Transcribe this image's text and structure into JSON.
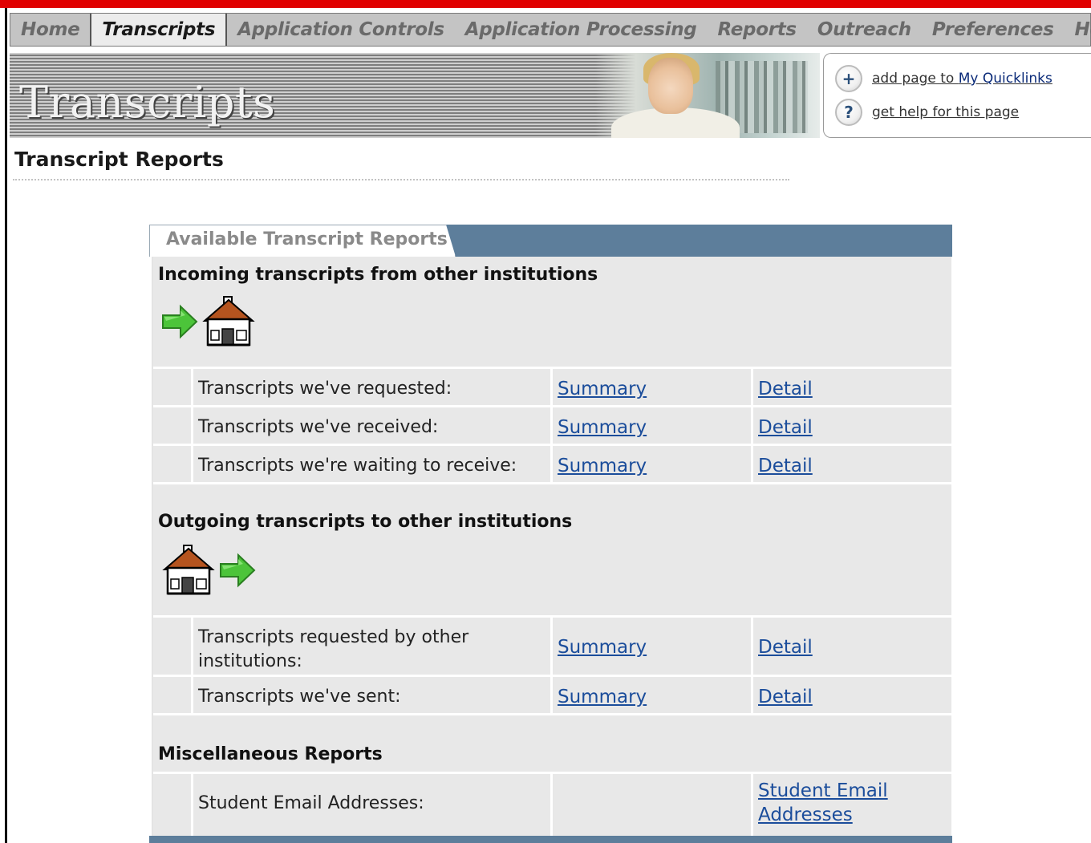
{
  "nav": {
    "items": [
      {
        "label": "Home",
        "active": false
      },
      {
        "label": "Transcripts",
        "active": true
      },
      {
        "label": "Application Controls",
        "active": false
      },
      {
        "label": "Application Processing",
        "active": false
      },
      {
        "label": "Reports",
        "active": false
      },
      {
        "label": "Outreach",
        "active": false
      },
      {
        "label": "Preferences",
        "active": false
      },
      {
        "label": "Help",
        "active": false
      }
    ]
  },
  "banner": {
    "title": "Transcripts"
  },
  "quicklinks": {
    "add_prefix": "add page to ",
    "add_emph": "My Quicklinks",
    "help": "get help for this page",
    "add_icon": "+",
    "help_icon": "?"
  },
  "page": {
    "heading": "Transcript Reports"
  },
  "panel": {
    "tab_label": "Available Transcript Reports",
    "sections": [
      {
        "title": "Incoming transcripts from other institutions",
        "icons": [
          "green-arrow-icon",
          "schoolhouse-icon"
        ],
        "rows": [
          {
            "label": "Transcripts we've requested:",
            "summary": "Summary",
            "detail": "Detail"
          },
          {
            "label": "Transcripts we've received:",
            "summary": "Summary",
            "detail": "Detail"
          },
          {
            "label": "Transcripts we're waiting to receive:",
            "summary": "Summary",
            "detail": "Detail"
          }
        ]
      },
      {
        "title": "Outgoing transcripts to other institutions",
        "icons": [
          "schoolhouse-icon",
          "green-arrow-icon"
        ],
        "rows": [
          {
            "label": "Transcripts requested by other institutions:",
            "summary": "Summary",
            "detail": "Detail"
          },
          {
            "label": "Transcripts we've sent:",
            "summary": "Summary",
            "detail": "Detail"
          }
        ]
      },
      {
        "title": "Miscellaneous Reports",
        "rows": [
          {
            "label": "Student Email Addresses:",
            "link": "Student Email Addresses"
          }
        ]
      }
    ]
  },
  "colors": {
    "accent_bar": "#e00000",
    "panel_header": "#5d7e9b",
    "link": "#1b4d9b",
    "arrow": "#4cc43a",
    "roof": "#b5541f"
  }
}
